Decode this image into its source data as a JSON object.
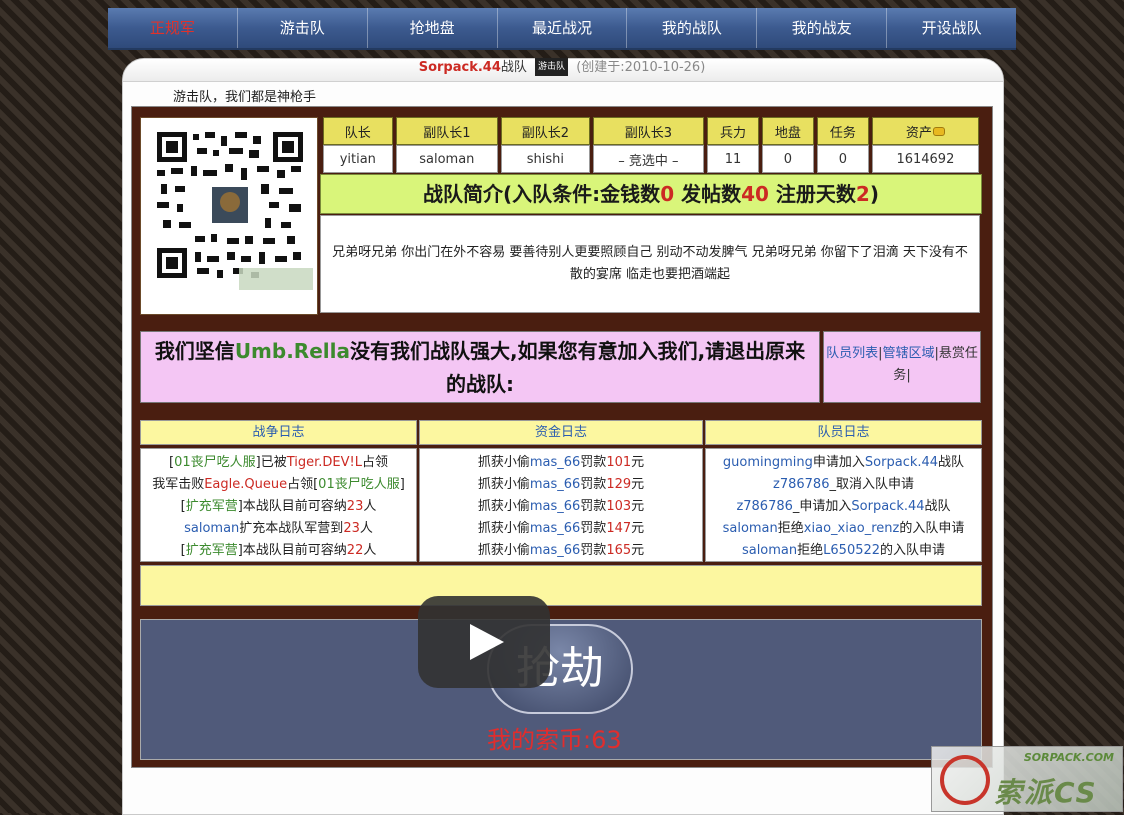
{
  "nav": {
    "items": [
      {
        "label": "正规军",
        "active": true
      },
      {
        "label": "游击队"
      },
      {
        "label": "抢地盘"
      },
      {
        "label": "最近战况"
      },
      {
        "label": "我的战队"
      },
      {
        "label": "我的战友"
      },
      {
        "label": "开设战队"
      }
    ]
  },
  "header": {
    "team_name": "Sorpack.44",
    "team_suffix": "战队",
    "team_tag": "游击队",
    "created": "(创建于:2010-10-26)",
    "slogan": "游击队，我们都是神枪手"
  },
  "stats": {
    "headers": [
      "队长",
      "副队长1",
      "副队长2",
      "副队长3",
      "兵力",
      "地盘",
      "任务",
      "资产"
    ],
    "values": [
      "yitian",
      "saloman",
      "shishi",
      "– 竞选中 –",
      "11",
      "0",
      "0",
      "1614692"
    ]
  },
  "intro": {
    "head_prefix": "战队简介(入队条件:金钱数",
    "money": "0",
    "posts_label": " 发帖数",
    "posts": "40",
    "days_label": " 注册天数",
    "days": "2",
    "head_suffix": ")",
    "body": "兄弟呀兄弟 你出门在外不容易 要善待别人更要照顾自己 别动不动发脾气 兄弟呀兄弟 你留下了泪滴 天下没有不散的宴席 临走也要把酒端起"
  },
  "banner": {
    "prefix": "我们坚信",
    "rival": "Umb.Rella",
    "suffix": "没有我们战队强大,如果您有意加入我们,请退出原来的战队:"
  },
  "links": {
    "members": "队员列表",
    "area": "管辖区域",
    "bounty": "悬赏任务",
    "sep": "|"
  },
  "logs": {
    "war_title": "战争日志",
    "fund_title": "资金日志",
    "member_title": "队员日志",
    "war": [
      [
        "[",
        "01丧尸吃人服",
        "]已被",
        "Tiger.DEV!L",
        "占领"
      ],
      [
        "我军击败",
        "Eagle.Queue",
        "占领[",
        "01丧尸吃人服",
        "]"
      ],
      [
        "[",
        "扩充军营",
        "]本战队目前可容纳",
        "23",
        "人"
      ],
      [
        "saloman",
        "扩充本战队军营到",
        "23",
        "人"
      ],
      [
        "[",
        "扩充军营",
        "]本战队目前可容纳",
        "22",
        "人"
      ]
    ],
    "fund": [
      {
        "a": "抓获小偷",
        "who": "mas_66",
        "b": "罚款",
        "amt": "101",
        "c": "元"
      },
      {
        "a": "抓获小偷",
        "who": "mas_66",
        "b": "罚款",
        "amt": "129",
        "c": "元"
      },
      {
        "a": "抓获小偷",
        "who": "mas_66",
        "b": "罚款",
        "amt": "103",
        "c": "元"
      },
      {
        "a": "抓获小偷",
        "who": "mas_66",
        "b": "罚款",
        "amt": "147",
        "c": "元"
      },
      {
        "a": "抓获小偷",
        "who": "mas_66",
        "b": "罚款",
        "amt": "165",
        "c": "元"
      }
    ],
    "member": [
      {
        "who": "guomingming",
        "text": "申请加入",
        "team": "Sorpack.44",
        "tail": "战队"
      },
      {
        "who": "z786786",
        "text": "_取消入队申请",
        "team": "",
        "tail": ""
      },
      {
        "who": "z786786",
        "text": "_申请加入",
        "team": "Sorpack.44",
        "tail": "战队"
      },
      {
        "who": "saloman",
        "text": "拒绝",
        "team": "xiao_xiao_renz",
        "tail": "的入队申请"
      },
      {
        "who": "saloman",
        "text": "拒绝",
        "team": "L650522",
        "tail": "的入队申请"
      }
    ]
  },
  "rob": {
    "button": "抢劫",
    "coins": "我的索币:63"
  },
  "watermark": {
    "url": "SORPACK.COM",
    "text": "索派CS"
  },
  "colors": {
    "accent": "#cc2a23",
    "link": "#2b5db0",
    "green": "#3c8a2e",
    "nav": "#3c5a8f"
  }
}
